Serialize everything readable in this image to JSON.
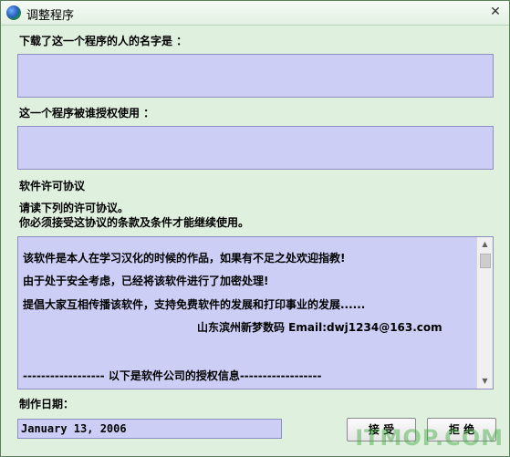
{
  "window": {
    "title": "调整程序",
    "close_glyph": "✕"
  },
  "labels": {
    "downloader": "下载了这一个程序的人的名字是 ：",
    "authorized_user": "这一个程序被谁授权使用 ：",
    "license_title": "软件许可协议",
    "instruction_1": "请读下列的许可协议。",
    "instruction_2": "你必须接受这协议的条款及条件才能继续使用。",
    "date_label": "制作日期："
  },
  "fields": {
    "downloader_name": "",
    "authorized_user_name": "",
    "date_value": "January 13, 2006"
  },
  "license_text": [
    "该软件是本人在学习汉化的时候的作品，如果有不足之处欢迎指教!",
    "由于处于安全考虑，已经将该软件进行了加密处理!",
    "提倡大家互相传播该软件，支持免费软件的发展和打印事业的发展......",
    "山东滨州新梦数码 Email:dwj1234@163.com",
    "------------------ 以下是软件公司的授权信息------------------"
  ],
  "buttons": {
    "accept": "接 受",
    "reject": "拒 绝"
  },
  "icons": {
    "app": "globe-icon",
    "close": "close-icon"
  },
  "watermark": "ITMOP.COM",
  "colors": {
    "window_bg": "#dff0df",
    "field_bg": "#cccef6"
  }
}
